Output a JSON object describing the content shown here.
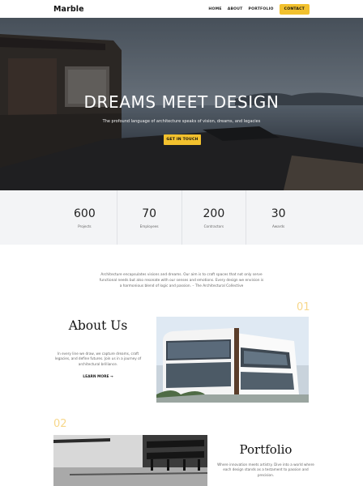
{
  "nav": {
    "logo": "Marble",
    "items": [
      {
        "label": "HOME"
      },
      {
        "label": "ABOUT"
      },
      {
        "label": "PORTFOLIO"
      }
    ],
    "cta": "CONTACT"
  },
  "hero": {
    "title": "DREAMS MEET DESIGN",
    "subtitle": "The profound language of architecture speaks of vision, dreams, and legacies",
    "button": "GET IN TOUCH"
  },
  "stats": [
    {
      "value": "600",
      "label": "Projects"
    },
    {
      "value": "70",
      "label": "Employees"
    },
    {
      "value": "200",
      "label": "Contractors"
    },
    {
      "value": "30",
      "label": "Awards"
    }
  ],
  "quote": "Architecture encapsulates visions and dreams. Our aim is to craft spaces that not only serve functional needs but also resonate with our senses and emotions. Every design we envision is a harmonious blend of logic and passion. – The Architectural Collective",
  "about": {
    "number": "01",
    "title": "About Us",
    "text": "In every line we draw, we capture dreams, craft legacies, and define futures. Join us in a journey of architectural brilliance.",
    "link": "LEARN MORE →"
  },
  "portfolio": {
    "number": "02",
    "title": "Portfolio",
    "text": "Where innovation meets artistry. Dive into a world where each design stands as a testament to passion and precision."
  },
  "colors": {
    "accent": "#f2c12e",
    "number_accent": "#f7d78a",
    "stats_bg": "#f3f4f6"
  }
}
